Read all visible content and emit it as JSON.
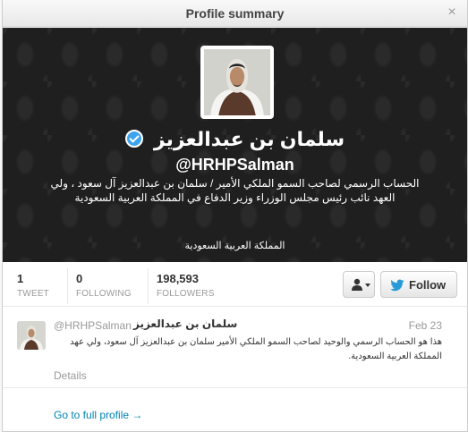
{
  "dialog": {
    "title": "Profile summary",
    "close_glyph": "×"
  },
  "profile": {
    "display_name": "سلمان بن عبدالعزيز",
    "handle": "@HRHPSalman",
    "bio": "الحساب الرسمي لصاحب السمو الملكي الأمير / سلمان بن عبدالعزيز آل سعود ، ولي العهد نائب رئيس مجلس الوزراء وزير الدفاع في المملكة العربية السعودية",
    "location": "المملكة العربية السعودية",
    "verified_icon": "verified-badge-icon",
    "accent": "#3ea4ec"
  },
  "stats": {
    "tweets": {
      "value": "1",
      "label": "TWEET"
    },
    "following": {
      "value": "0",
      "label": "FOLLOWING"
    },
    "followers": {
      "value": "198,593",
      "label": "FOLLOWERS"
    }
  },
  "actions": {
    "follow_label": "Follow",
    "user_menu_icon": "user-dropdown-icon",
    "follow_icon": "twitter-bird-icon",
    "brand_color": "#2a9ad6"
  },
  "tweet": {
    "name": "سلمان بن عبدالعزيز",
    "handle": "@HRHPSalman",
    "date": "Feb 23",
    "text": "هذا هو الحساب الرسمي والوحيد لصاحب السمو الملكي الأمير سلمان بن عبدالعزيز آل سعود، ولي عهد المملكة العربية السعودية.",
    "details_label": "Details"
  },
  "footer": {
    "full_profile_label": "Go to full profile →",
    "link_color": "#0084b4"
  }
}
